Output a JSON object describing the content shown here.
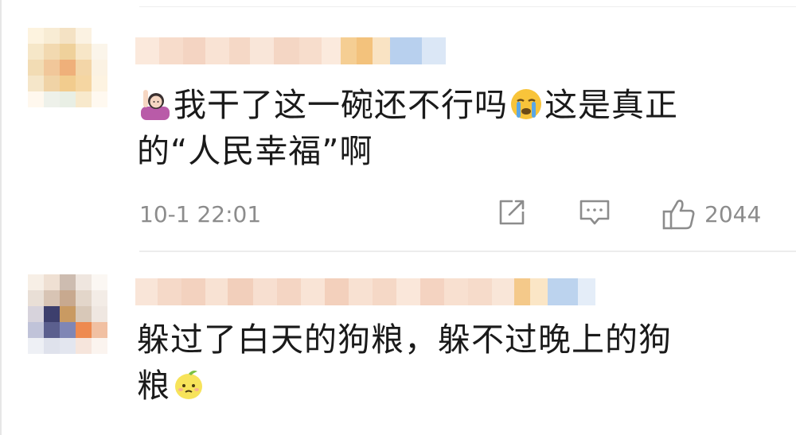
{
  "comments": [
    {
      "text_line1": "我干了这一碗还不行吗",
      "text_line1b": "这是真正",
      "text_line2": "的“人民幸福”啊",
      "timestamp": "10-1 22:01",
      "like_count": "2044",
      "icons": [
        "woman-raising-hand-icon",
        "crying-face-icon",
        "share-icon",
        "comment-icon",
        "thumbs-up-icon"
      ]
    },
    {
      "text_line1": "躲过了白天的狗粮，躲不过晚上的狗",
      "text_line2": "粮",
      "icons": [
        "lemon-face-icon"
      ]
    }
  ]
}
